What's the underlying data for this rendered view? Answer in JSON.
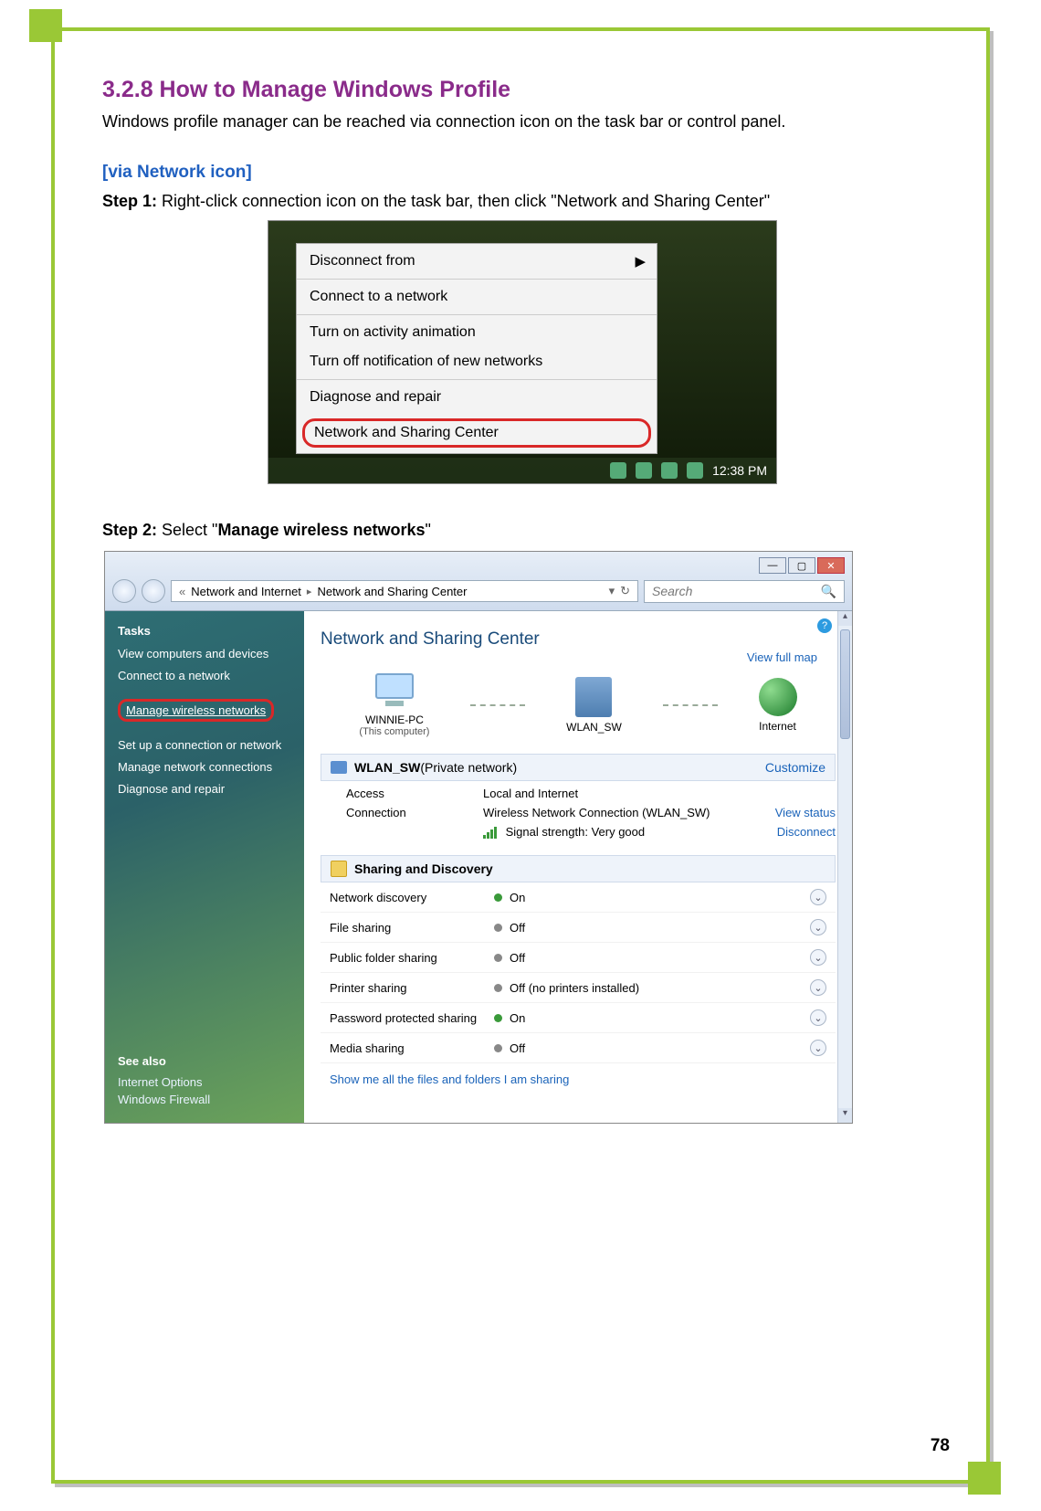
{
  "page_number": "78",
  "heading": "3.2.8   How to Manage Windows Profile",
  "intro": "Windows profile manager can be reached via connection icon on the task bar or control panel.",
  "via_network": "[via Network icon]",
  "step1_prefix": "Step 1:",
  "step1_text": " Right-click connection icon on the task bar, then click \"Network and Sharing Center\"",
  "context_menu": {
    "disconnect": "Disconnect from",
    "connect": "Connect to a network",
    "turn_on_activity": "Turn on activity animation",
    "turn_off_notif": "Turn off notification of new networks",
    "diagnose": "Diagnose and repair",
    "nsc": "Network and Sharing Center",
    "arrow": "▶",
    "clock": "12:38 PM"
  },
  "step2_prefix": "Step 2:",
  "step2_a": " Select \"",
  "step2_bold": "Manage wireless networks",
  "step2_b": "\"",
  "window": {
    "chev": "«",
    "sep": "▸",
    "crumb1": "Network and Internet",
    "crumb2": "Network and Sharing Center",
    "search_ph": "Search",
    "search_icon": "🔍",
    "dd": "▾",
    "refresh": "↻",
    "help": "?",
    "ctl_min": "—",
    "ctl_max": "▢",
    "ctl_close": "✕",
    "up": "▴",
    "dn": "▾"
  },
  "tasks": {
    "hd": "Tasks",
    "view_computers": "View computers and devices",
    "connect": "Connect to a network",
    "manage_wireless": "Manage wireless networks",
    "setup_conn": "Set up a connection or network",
    "manage_conn": "Manage network connections",
    "diagnose": "Diagnose and repair"
  },
  "seealso": {
    "hd": "See also",
    "internet_options": "Internet Options",
    "windows_firewall": "Windows Firewall"
  },
  "main": {
    "title": "Network and Sharing Center",
    "view_full_map": "View full map",
    "pc_name": "WINNIE-PC",
    "pc_sub": "(This computer)",
    "mid_name": "WLAN_SW",
    "internet": "Internet",
    "net_name": "WLAN_SW",
    "net_type": " (Private network)",
    "customize": "Customize",
    "access_k": "Access",
    "access_v": "Local and Internet",
    "conn_k": "Connection",
    "conn_v": "Wireless Network Connection (WLAN_SW)",
    "signal_v": "Signal strength:  Very good",
    "view_status": "View status",
    "disconnect": "Disconnect",
    "sd_hd": "Sharing and Discovery",
    "showme": "Show me all the files and folders I am sharing",
    "exp": "⌄"
  },
  "sd": {
    "r1_k": "Network discovery",
    "r1_v": "On",
    "r2_k": "File sharing",
    "r2_v": "Off",
    "r3_k": "Public folder sharing",
    "r3_v": "Off",
    "r4_k": "Printer sharing",
    "r4_v": "Off (no printers installed)",
    "r5_k": "Password protected sharing",
    "r5_v": "On",
    "r6_k": "Media sharing",
    "r6_v": "Off"
  }
}
